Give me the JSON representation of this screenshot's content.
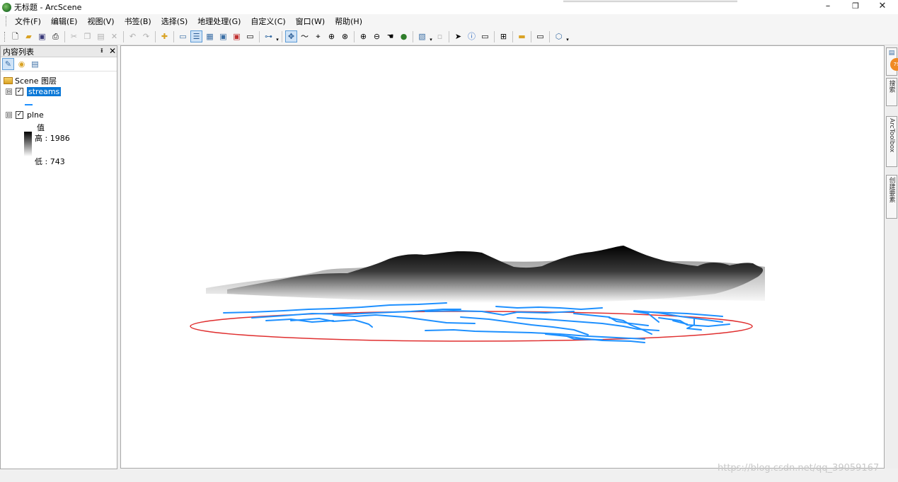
{
  "window": {
    "title": "无标题 - ArcScene",
    "minimize": "–",
    "maximize": "❐",
    "close": "✕"
  },
  "menu": [
    "文件(F)",
    "编辑(E)",
    "视图(V)",
    "书签(B)",
    "选择(S)",
    "地理处理(G)",
    "自定义(C)",
    "窗口(W)",
    "帮助(H)"
  ],
  "toc": {
    "title": "内容列表",
    "pin": "ᵻ",
    "close": "✕",
    "scene_layers_label": "Scene 图层",
    "layers": [
      {
        "name": "streams",
        "checked": true,
        "expanded": true
      },
      {
        "name": "plne",
        "checked": true,
        "expanded": true
      }
    ],
    "legend": {
      "value_label": "值",
      "high_label": "高 : 1986",
      "low_label": "低 : 743"
    },
    "expander_symbol": "⊟",
    "check_symbol": "✓"
  },
  "right_dock": {
    "tabs": [
      "搜索",
      "ArcToolbox",
      "创建要素"
    ],
    "badge": "79"
  },
  "watermark": "https://blog.csdn.net/qq_39059167",
  "colors": {
    "streams": "#1e90ff",
    "ellipse": "#e03030",
    "selection": "#0a78d7"
  }
}
